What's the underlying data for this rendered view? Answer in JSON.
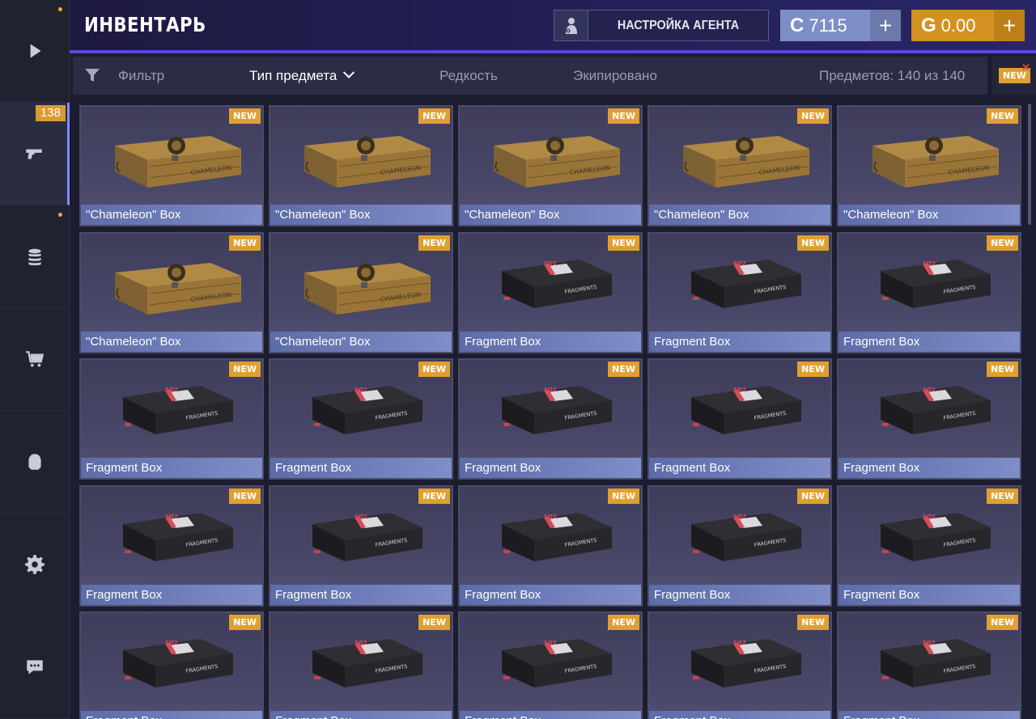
{
  "header": {
    "title": "ИНВЕНТАРЬ",
    "agent_button": "НАСТРОЙКА АГЕНТА",
    "silver_balance": "7115",
    "gold_balance": "0.00",
    "silver_symbol": "C",
    "gold_symbol": "G",
    "plus": "+"
  },
  "sidebar": {
    "badge_count": "138",
    "items": [
      {
        "name": "play-icon"
      },
      {
        "name": "pistol-icon"
      },
      {
        "name": "coins-icon"
      },
      {
        "name": "cart-icon"
      },
      {
        "name": "clan-icon"
      },
      {
        "name": "gear-icon"
      },
      {
        "name": "chat-icon"
      }
    ]
  },
  "filterbar": {
    "filter_label": "Фильтр",
    "type_label": "Тип предмета",
    "rarity_label": "Редкость",
    "equipped_label": "Экипировано",
    "count_label": "Предметов: 140 из 140",
    "new_label": "NEW"
  },
  "items": [
    {
      "label": "\"Chameleon\" Box",
      "kind": "chameleon",
      "badge": "NEW"
    },
    {
      "label": "\"Chameleon\" Box",
      "kind": "chameleon",
      "badge": "NEW"
    },
    {
      "label": "\"Chameleon\" Box",
      "kind": "chameleon",
      "badge": "NEW"
    },
    {
      "label": "\"Chameleon\" Box",
      "kind": "chameleon",
      "badge": "NEW"
    },
    {
      "label": "\"Chameleon\" Box",
      "kind": "chameleon",
      "badge": "NEW"
    },
    {
      "label": "\"Chameleon\" Box",
      "kind": "chameleon",
      "badge": "NEW"
    },
    {
      "label": "\"Chameleon\" Box",
      "kind": "chameleon",
      "badge": "NEW"
    },
    {
      "label": "Fragment Box",
      "kind": "fragment",
      "badge": "NEW"
    },
    {
      "label": "Fragment Box",
      "kind": "fragment",
      "badge": "NEW"
    },
    {
      "label": "Fragment Box",
      "kind": "fragment",
      "badge": "NEW"
    },
    {
      "label": "Fragment Box",
      "kind": "fragment",
      "badge": "NEW"
    },
    {
      "label": "Fragment Box",
      "kind": "fragment",
      "badge": "NEW"
    },
    {
      "label": "Fragment Box",
      "kind": "fragment",
      "badge": "NEW"
    },
    {
      "label": "Fragment Box",
      "kind": "fragment",
      "badge": "NEW"
    },
    {
      "label": "Fragment Box",
      "kind": "fragment",
      "badge": "NEW"
    },
    {
      "label": "Fragment Box",
      "kind": "fragment",
      "badge": "NEW"
    },
    {
      "label": "Fragment Box",
      "kind": "fragment",
      "badge": "NEW"
    },
    {
      "label": "Fragment Box",
      "kind": "fragment",
      "badge": "NEW"
    },
    {
      "label": "Fragment Box",
      "kind": "fragment",
      "badge": "NEW"
    },
    {
      "label": "Fragment Box",
      "kind": "fragment",
      "badge": "NEW"
    },
    {
      "label": "Fragment Box",
      "kind": "fragment",
      "badge": "NEW"
    },
    {
      "label": "Fragment Box",
      "kind": "fragment",
      "badge": "NEW"
    },
    {
      "label": "Fragment Box",
      "kind": "fragment",
      "badge": "NEW"
    },
    {
      "label": "Fragment Box",
      "kind": "fragment",
      "badge": "NEW"
    },
    {
      "label": "Fragment Box",
      "kind": "fragment",
      "badge": "NEW"
    }
  ],
  "box_art": {
    "chameleon_text": "CHAMELEON",
    "fragment_text": "FRAGMENTS",
    "fragment_logo": "SO2"
  }
}
